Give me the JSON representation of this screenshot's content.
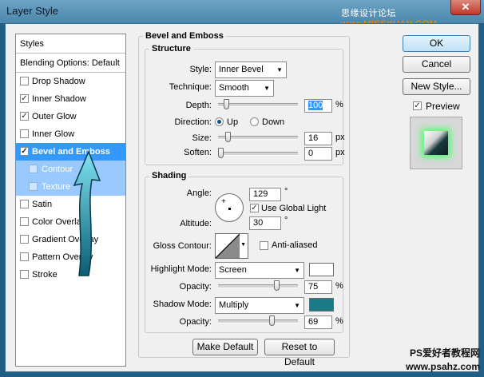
{
  "window": {
    "title": "Layer Style",
    "watermark_prefix": "思缘设计论坛",
    "watermark_url": "www.MISSYUAN.COM",
    "close_glyph": "✕"
  },
  "styles_panel": {
    "header": "Styles",
    "blending": "Blending Options: Default",
    "items": [
      {
        "label": "Drop Shadow",
        "checked": false
      },
      {
        "label": "Inner Shadow",
        "checked": true
      },
      {
        "label": "Outer Glow",
        "checked": true
      },
      {
        "label": "Inner Glow",
        "checked": false
      },
      {
        "label": "Bevel and Emboss",
        "checked": true,
        "selected": true
      },
      {
        "label": "Contour",
        "checked": false,
        "sub": true
      },
      {
        "label": "Texture",
        "checked": false,
        "sub": true
      },
      {
        "label": "Satin",
        "checked": false
      },
      {
        "label": "Color Overlay",
        "checked": false
      },
      {
        "label": "Gradient Overlay",
        "checked": false
      },
      {
        "label": "Pattern Overlay",
        "checked": false
      },
      {
        "label": "Stroke",
        "checked": false
      }
    ]
  },
  "bevel": {
    "section_title": "Bevel and Emboss",
    "structure_title": "Structure",
    "style_label": "Style:",
    "style_value": "Inner Bevel",
    "technique_label": "Technique:",
    "technique_value": "Smooth",
    "depth_label": "Depth:",
    "depth_value": "100",
    "depth_unit": "%",
    "direction_label": "Direction:",
    "direction_up": "Up",
    "direction_down": "Down",
    "size_label": "Size:",
    "size_value": "16",
    "size_unit": "px",
    "soften_label": "Soften:",
    "soften_value": "0",
    "soften_unit": "px"
  },
  "shading": {
    "title": "Shading",
    "angle_label": "Angle:",
    "angle_value": "129",
    "degree": "°",
    "global_light_label": "Use Global Light",
    "altitude_label": "Altitude:",
    "altitude_value": "30",
    "gloss_label": "Gloss Contour:",
    "anti_aliased_label": "Anti-aliased",
    "highlight_mode_label": "Highlight Mode:",
    "highlight_mode_value": "Screen",
    "highlight_opacity_label": "Opacity:",
    "highlight_opacity_value": "75",
    "shadow_mode_label": "Shadow Mode:",
    "shadow_mode_value": "Multiply",
    "shadow_opacity_label": "Opacity:",
    "shadow_opacity_value": "69",
    "percent": "%",
    "highlight_color": "#ffffff",
    "shadow_color": "#1a7a86"
  },
  "levels": {
    "depth": 0.07,
    "size": 0.1,
    "soften": 0.0,
    "highlight_opacity": 0.75,
    "shadow_opacity": 0.69
  },
  "buttons": {
    "ok": "OK",
    "cancel": "Cancel",
    "new_style": "New Style...",
    "preview_label": "Preview",
    "make_default": "Make Default",
    "reset_default": "Reset to Default"
  },
  "footer_watermark": {
    "line1": "PS爱好者教程网",
    "line2": "www.psahz.com"
  }
}
